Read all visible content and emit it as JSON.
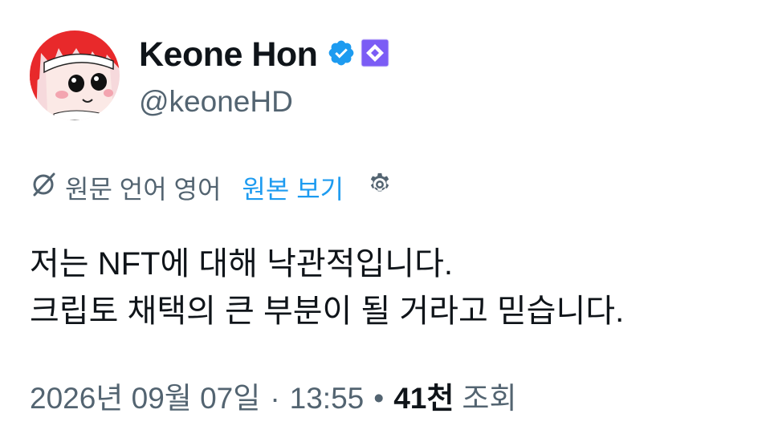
{
  "author": {
    "display_name": "Keone Hon",
    "handle": "@keoneHD",
    "icons": [
      "verified-badge-icon",
      "affiliate-badge-icon"
    ]
  },
  "translation": {
    "source_label": "원문 언어 영어",
    "view_original_label": "원본 보기",
    "icons": [
      "translate-icon",
      "gear-icon"
    ]
  },
  "tweet": {
    "lines": [
      "저는 NFT에 대해 낙관적입니다.",
      "크립토 채택의 큰 부분이 될 거라고 믿습니다."
    ]
  },
  "meta": {
    "date": "2026년 09월 07일",
    "separator": "·",
    "time": "13:55",
    "bullet": "•",
    "views_count": "41천",
    "views_label": "조회"
  },
  "colors": {
    "text_primary": "#0f1419",
    "text_secondary": "#536471",
    "link": "#1d9bf0",
    "verified": "#1d9bf0",
    "affiliate": "#7b5cf5"
  }
}
